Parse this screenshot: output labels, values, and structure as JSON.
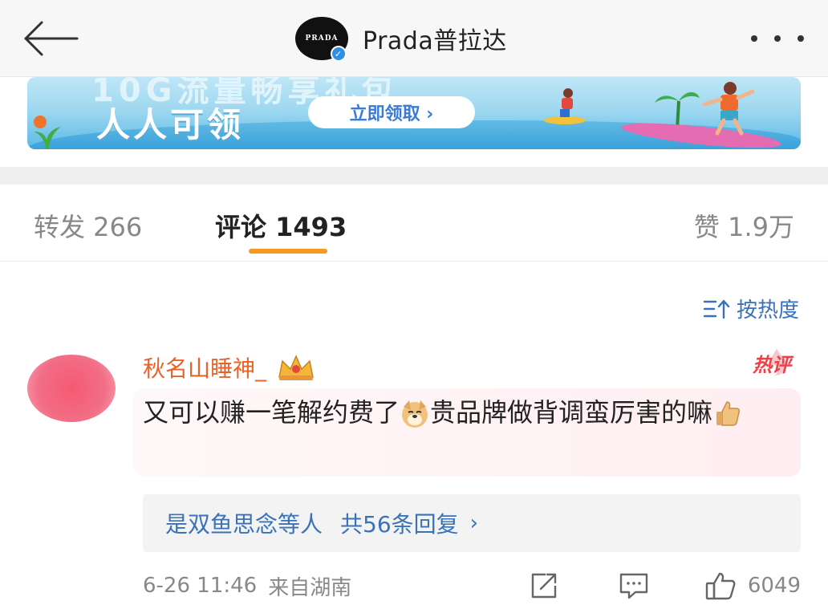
{
  "header": {
    "title": "Prada普拉达",
    "avatar_text": "PRADA",
    "verified_mark": "✓"
  },
  "banner": {
    "top_text": "10G流量畅享礼包",
    "main_text": "人人可领",
    "button_label": "立即领取 ›"
  },
  "tabs": [
    {
      "label": "转发 266",
      "active": false
    },
    {
      "label": "评论 1493",
      "active": true
    },
    {
      "label": "赞 1.9万",
      "active": false
    }
  ],
  "sort": {
    "label": "按热度"
  },
  "comment": {
    "username": "秋名山睡神_",
    "hot_label": "热评",
    "text_part1": "又可以赚一笔解约费了",
    "text_part2": "贵品牌做背调蛮厉害的嘛",
    "reply_user": "是双鱼思念等人",
    "reply_count": "共56条回复",
    "reply_chevron": "›",
    "time": "6-26 11:46",
    "location": "来自湖南",
    "likes": "6049"
  },
  "colors": {
    "accent": "#f59a23",
    "username": "#e8632a",
    "link": "#3a72b8",
    "hot": "#e8434b"
  }
}
